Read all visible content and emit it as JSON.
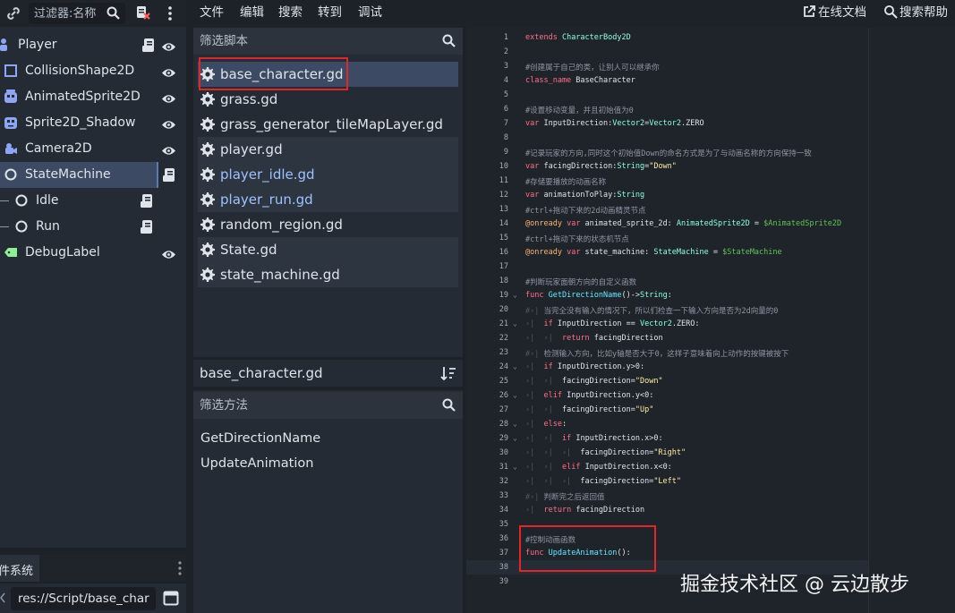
{
  "scene_dock": {
    "filter_placeholder": "过滤器:名称",
    "nodes": [
      {
        "label": "Player",
        "icon": "character-body-icon",
        "color": "#8da5f3",
        "has_script": true,
        "visible": true
      },
      {
        "label": "CollisionShape2D",
        "icon": "collision-shape-icon",
        "color": "#8da5f3",
        "has_script": false,
        "visible": true
      },
      {
        "label": "AnimatedSprite2D",
        "icon": "animated-sprite-icon",
        "color": "#8da5f3",
        "has_script": false,
        "visible": true
      },
      {
        "label": "Sprite2D_Shadow",
        "icon": "sprite-icon",
        "color": "#8da5f3",
        "has_script": false,
        "visible": true
      },
      {
        "label": "Camera2D",
        "icon": "camera-icon",
        "color": "#8da5f3",
        "has_script": false,
        "visible": true
      },
      {
        "label": "StateMachine",
        "icon": "node-icon",
        "color": "#dfe3ea",
        "has_script": true,
        "visible": false,
        "selected": true
      },
      {
        "label": "Idle",
        "icon": "node-icon",
        "color": "#dfe3ea",
        "has_script": true,
        "visible": false
      },
      {
        "label": "Run",
        "icon": "node-icon",
        "color": "#dfe3ea",
        "has_script": true,
        "visible": false
      },
      {
        "label": "DebugLabel",
        "icon": "label-icon",
        "color": "#8eef97",
        "has_script": false,
        "visible": true
      }
    ]
  },
  "filesystem_dock": {
    "tab_label": "件系统",
    "path": "res://Script/base_char"
  },
  "menubar": {
    "items": [
      "文件",
      "编辑",
      "搜索",
      "转到",
      "调试"
    ],
    "online_docs": "在线文档",
    "search_help": "搜索帮助"
  },
  "script_list": {
    "filter_placeholder": "筛选脚本",
    "scripts": [
      {
        "name": "base_character.gd",
        "state": "selected",
        "blue": false
      },
      {
        "name": "grass.gd",
        "state": "normal",
        "blue": false
      },
      {
        "name": "grass_generator_tileMapLayer.gd",
        "state": "normal",
        "blue": false
      },
      {
        "name": "player.gd",
        "state": "open",
        "blue": false
      },
      {
        "name": "player_idle.gd",
        "state": "open",
        "blue": true
      },
      {
        "name": "player_run.gd",
        "state": "open",
        "blue": true
      },
      {
        "name": "random_region.gd",
        "state": "normal",
        "blue": false
      },
      {
        "name": "State.gd",
        "state": "open",
        "blue": false
      },
      {
        "name": "state_machine.gd",
        "state": "open",
        "blue": false
      }
    ],
    "current_script": "base_character.gd",
    "method_filter_placeholder": "筛选方法",
    "methods": [
      "GetDirectionName",
      "UpdateAnimation"
    ]
  },
  "editor": {
    "lines": [
      {
        "n": "1",
        "fold": false,
        "html": "<span class='kw'>extends</span> <span class='ty'>CharacterBody2D</span>"
      },
      {
        "n": "2",
        "fold": false,
        "html": ""
      },
      {
        "n": "3",
        "fold": false,
        "html": "<span class='cm'>#创建属于自己的类，让别人可以继承你</span>"
      },
      {
        "n": "4",
        "fold": false,
        "html": "<span class='kw'>class_name</span> BaseCharacter"
      },
      {
        "n": "5",
        "fold": false,
        "html": ""
      },
      {
        "n": "6",
        "fold": false,
        "html": "<span class='cm'>#设置移动变量，并且初始值为0</span>"
      },
      {
        "n": "7",
        "fold": false,
        "html": "<span class='kw'>var</span> InputDirection:<span class='ty'>Vector2</span>=<span class='ty'>Vector2</span>.ZERO"
      },
      {
        "n": "8",
        "fold": false,
        "html": ""
      },
      {
        "n": "9",
        "fold": false,
        "html": "<span class='cm'>#记录玩家的方向,同时这个初始值Down的命名方式是为了与动画名称的方向保持一致</span>"
      },
      {
        "n": "10",
        "fold": false,
        "html": "<span class='kw'>var</span> facingDirection:<span class='ty'>String</span>=<span class='st'>\"Down\"</span>"
      },
      {
        "n": "11",
        "fold": false,
        "html": "<span class='cm'>#存储要播放的动画名称</span>"
      },
      {
        "n": "12",
        "fold": false,
        "html": "<span class='kw'>var</span> animationToPlay:<span class='ty'>String</span>"
      },
      {
        "n": "13",
        "fold": false,
        "html": "<span class='cm'>#ctrl+拖动下来的2d动画精灵节点</span>"
      },
      {
        "n": "14",
        "fold": false,
        "html": "<span class='an'>@onready</span> <span class='kw'>var</span> animated_sprite_2d: <span class='ty'>AnimatedSprite2D</span> = <span class='nd'>$AnimatedSprite2D</span>"
      },
      {
        "n": "15",
        "fold": false,
        "html": "<span class='cm'>#ctrl+拖动下来的状态机节点</span>"
      },
      {
        "n": "16",
        "fold": false,
        "html": "<span class='an'>@onready</span> <span class='kw'>var</span> state_machine: <span class='ty'>StateMachine</span> = <span class='nd'>$StateMachine</span>"
      },
      {
        "n": "17",
        "fold": false,
        "html": ""
      },
      {
        "n": "18",
        "fold": false,
        "html": "<span class='cm'>#判断玩家面朝方向的自定义函数</span>"
      },
      {
        "n": "19",
        "fold": true,
        "html": "<span class='kw'>func</span> <span class='fn'>GetDirectionName</span>()-><span class='ty'>String</span>:"
      },
      {
        "n": "20",
        "fold": false,
        "html": "<span class='tab'>#›|</span><span class='cm'> 当完全没有输入的情况下，所以们检查一下输入方向是否为2d向量的0</span>"
      },
      {
        "n": "21",
        "fold": true,
        "html": "<span class='tab'>›|</span>  <span class='kw'>if</span> InputDirection == <span class='ty'>Vector2</span>.ZERO:"
      },
      {
        "n": "22",
        "fold": false,
        "html": "<span class='tab'>›|  ›|</span>  <span class='kw'>return</span> facingDirection"
      },
      {
        "n": "23",
        "fold": false,
        "html": "<span class='tab'>#›|</span><span class='cm'> 检测输入方向，比如y轴是否大于0，这样子意味着向上动作的按键被按下</span>"
      },
      {
        "n": "24",
        "fold": true,
        "html": "<span class='tab'>›|</span>  <span class='kw'>if</span> InputDirection.y>0:"
      },
      {
        "n": "25",
        "fold": false,
        "html": "<span class='tab'>›|  ›|</span>  facingDirection=<span class='st'>\"Down\"</span>"
      },
      {
        "n": "26",
        "fold": true,
        "html": "<span class='tab'>›|</span>  <span class='kw'>elif</span> InputDirection.y<0:"
      },
      {
        "n": "27",
        "fold": false,
        "html": "<span class='tab'>›|  ›|</span>  facingDirection=<span class='st'>\"Up\"</span>"
      },
      {
        "n": "28",
        "fold": true,
        "html": "<span class='tab'>›|</span>  <span class='kw'>else</span>:"
      },
      {
        "n": "29",
        "fold": true,
        "html": "<span class='tab'>›|  ›|</span>  <span class='kw'>if</span> InputDirection.x>0:"
      },
      {
        "n": "30",
        "fold": false,
        "html": "<span class='tab'>›|  ›|  ›|</span>  facingDirection=<span class='st'>\"Right\"</span>"
      },
      {
        "n": "31",
        "fold": true,
        "html": "<span class='tab'>›|  ›|</span>  <span class='kw'>elif</span> InputDirection.x<0:"
      },
      {
        "n": "32",
        "fold": false,
        "html": "<span class='tab'>›|  ›|  ›|</span>  facingDirection=<span class='st'>\"Left\"</span>"
      },
      {
        "n": "33",
        "fold": false,
        "html": "<span class='tab'>#›|</span><span class='cm'> 判断完之后返回值</span>"
      },
      {
        "n": "34",
        "fold": false,
        "html": "<span class='tab'>›|</span>  <span class='kw'>return</span> facingDirection"
      },
      {
        "n": "35",
        "fold": false,
        "html": ""
      },
      {
        "n": "36",
        "fold": false,
        "html": "<span class='cm'>#控制动画函数</span>"
      },
      {
        "n": "37",
        "fold": false,
        "html": "<span class='kw'>func</span> <span class='fn'>UpdateAnimation</span>():"
      },
      {
        "n": "38",
        "fold": false,
        "html": "",
        "highlight": true
      },
      {
        "n": "39",
        "fold": false,
        "html": ""
      }
    ]
  },
  "watermark": "掘金技术社区 @ 云边散步"
}
